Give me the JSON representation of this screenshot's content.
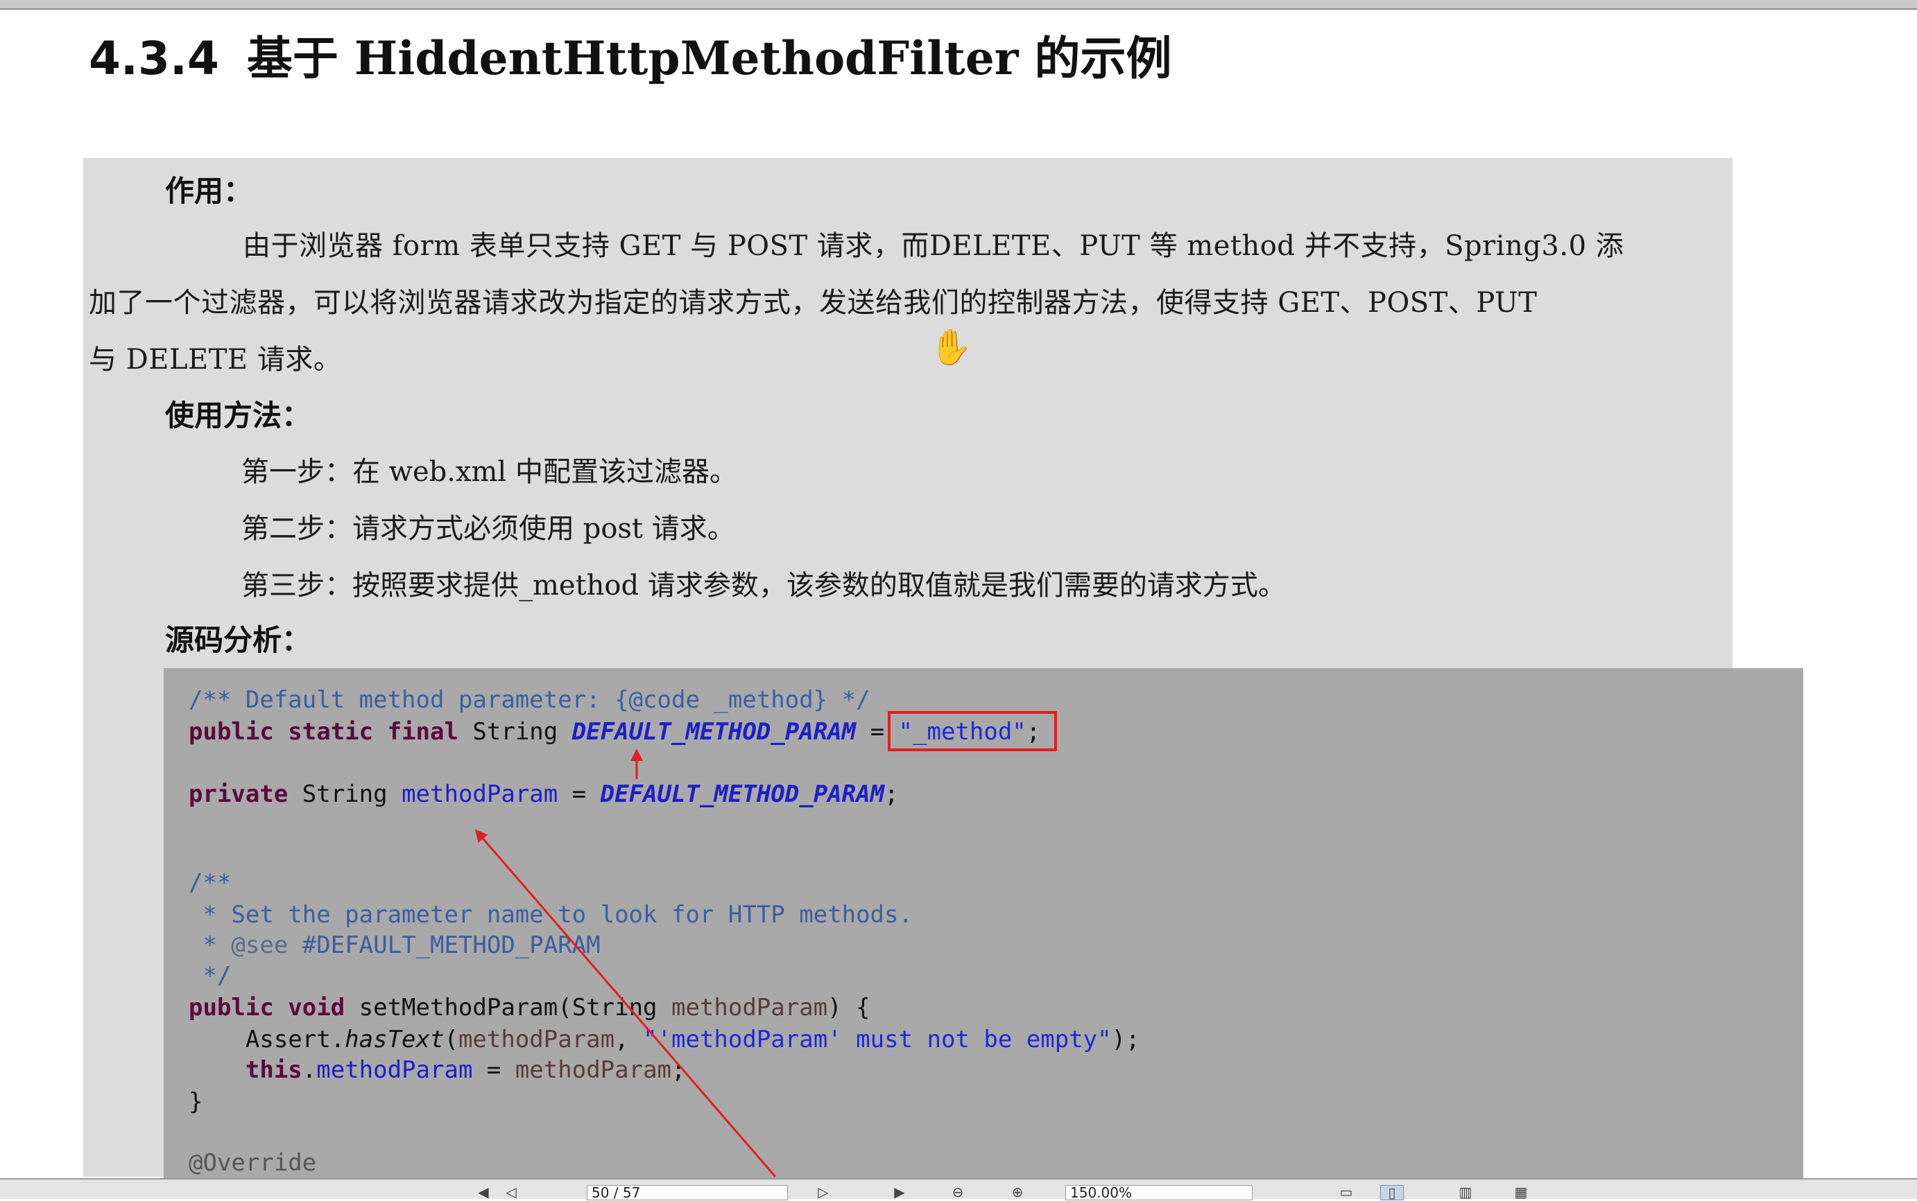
{
  "heading": {
    "number": "4.3.4",
    "title": "基于 HiddentHttpMethodFilter 的示例"
  },
  "purpose": {
    "label": "作用：",
    "line1": "由于浏览器 form 表单只支持 GET 与 POST 请求，而DELETE、PUT 等 method 并不支持，Spring3.0 添",
    "line2": "加了一个过滤器，可以将浏览器请求改为指定的请求方式，发送给我们的控制器方法，使得支持 GET、POST、PUT",
    "line3": "与 DELETE 请求。"
  },
  "usage": {
    "label": "使用方法：",
    "steps": [
      "第一步：在 web.xml 中配置该过滤器。",
      "第二步：请求方式必须使用 post 请求。",
      "第三步：按照要求提供_method 请求参数，该参数的取值就是我们需要的请求方式。"
    ]
  },
  "source": {
    "label": "源码分析：",
    "code": {
      "l1": "/** Default method parameter: {@code _method} */",
      "l2_kw": "public static final",
      "l2_type": " String ",
      "l2_const": "DEFAULT_METHOD_PARAM",
      "l2_eq": " = ",
      "l2_str": "\"_method\"",
      "l2_end": ";",
      "l3_kw": "private",
      "l3_type": " String ",
      "l3_field": "methodParam",
      "l3_eq": " = ",
      "l3_const": "DEFAULT_METHOD_PARAM",
      "l3_end": ";",
      "l4": "/**",
      "l5": " * Set the parameter name to look for HTTP methods.",
      "l6_star": " * ",
      "l6_tag": "@see",
      "l6_rest": " #DEFAULT_METHOD_PARAM",
      "l7": " */",
      "l8_kw": "public void",
      "l8_sig": " setMethodParam(String ",
      "l8_param": "methodParam",
      "l8_end": ") {",
      "l9_a": "    Assert.",
      "l9_call": "hasText",
      "l9_b": "(",
      "l9_param": "methodParam",
      "l9_c": ", ",
      "l9_str": "\"'methodParam' must not be empty\"",
      "l9_end": ");",
      "l10_kw": "    this",
      "l10_dot": ".",
      "l10_field": "methodParam",
      "l10_eq": " = ",
      "l10_param": "methodParam",
      "l10_end": ";",
      "l11": "}",
      "l12": "@Override"
    }
  },
  "toolbar": {
    "page_field": "50 / 57",
    "zoom_field": "150.00%"
  },
  "colors": {
    "highlight_box": "#e02020",
    "arrow": "#e02020",
    "panel_bg": "#dcdcdc",
    "code_bg": "#a9a9a9"
  },
  "icons": [
    "hand-cursor-icon",
    "arrow-up-icon",
    "arrow-diagonal-icon"
  ]
}
